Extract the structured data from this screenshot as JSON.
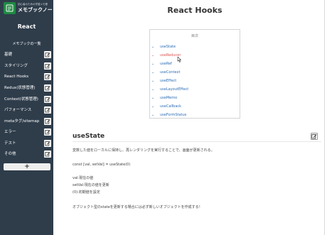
{
  "sidebar": {
    "logo_subtext": "初心者のための学習メモ帳",
    "logo_text": "メモブックノート",
    "title": "React",
    "section_label": "メモブックの一覧",
    "items": [
      {
        "label": "基礎"
      },
      {
        "label": "スタイリング"
      },
      {
        "label": "React Hooks"
      },
      {
        "label": "Redux(状態管理)"
      },
      {
        "label": "Context(状態管理)"
      },
      {
        "label": "パフォーマンス"
      },
      {
        "label": "metaタグ/sitemap"
      },
      {
        "label": "エラー"
      },
      {
        "label": "テスト"
      },
      {
        "label": "その他"
      }
    ],
    "add_label": "+"
  },
  "main": {
    "title": "React Hooks",
    "toc": {
      "title": "目次",
      "chevron": "⌄",
      "items": [
        {
          "label": "useState"
        },
        {
          "label": "useReducer",
          "active": true
        },
        {
          "label": "useRef"
        },
        {
          "label": "useContext"
        },
        {
          "label": "useEffect"
        },
        {
          "label": "useLayoutEffect"
        },
        {
          "label": "useMemo"
        },
        {
          "label": "useCallback"
        },
        {
          "label": "useFormStatus"
        }
      ]
    },
    "section": {
      "title": "useState",
      "description": "変数した値をローカルに保持し、再レンダリングを実行することで、画面が更新される。",
      "code": "const [val, setVal] = useState(0)",
      "notes": [
        "val:現在の値",
        "setVal:現在の値を更新",
        "(0):初期値を設定"
      ],
      "footer": "オブジェクト型のstateを更新する場合には必ず新しいオブジェクトを作成する！"
    }
  },
  "colors": {
    "sidebar_bg": "#2f3d4b",
    "logo_green": "#1f8a43",
    "link_blue": "#2b6db5",
    "active_red": "#d9534f"
  },
  "icons": [
    "notebook-logo-icon",
    "edit-icon",
    "chevron-down-icon",
    "cursor-pointer-icon"
  ]
}
